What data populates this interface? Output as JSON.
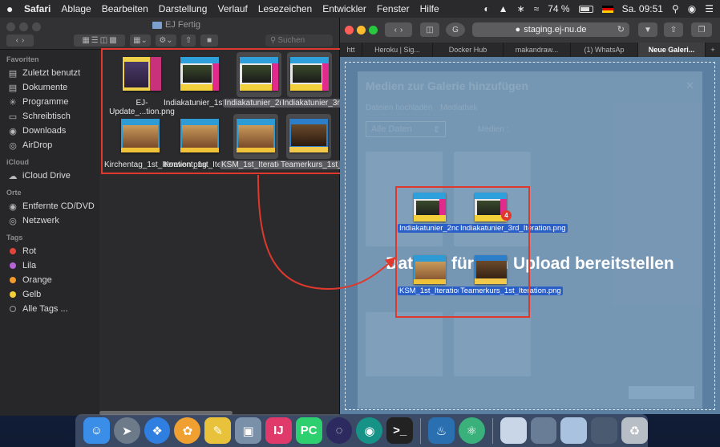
{
  "menubar": {
    "apple_icon": "apple-logo",
    "items": [
      "Safari",
      "Ablage",
      "Bearbeiten",
      "Darstellung",
      "Verlauf",
      "Lesezeichen",
      "Entwickler",
      "Fenster",
      "Hilfe"
    ],
    "battery": "74 %",
    "clock": "Sa. 09:51"
  },
  "finder": {
    "title": "EJ Fertig",
    "search_placeholder": "Suchen",
    "sidebar": {
      "favorites_heading": "Favoriten",
      "favorites": [
        {
          "label": "Zuletzt benutzt",
          "icon": "clock-icon"
        },
        {
          "label": "Dokumente",
          "icon": "document-icon"
        },
        {
          "label": "Programme",
          "icon": "apps-icon"
        },
        {
          "label": "Schreibtisch",
          "icon": "desktop-icon"
        },
        {
          "label": "Downloads",
          "icon": "download-icon"
        },
        {
          "label": "AirDrop",
          "icon": "airdrop-icon"
        }
      ],
      "icloud_heading": "iCloud",
      "icloud": [
        {
          "label": "iCloud Drive",
          "icon": "cloud-icon"
        }
      ],
      "places_heading": "Orte",
      "places": [
        {
          "label": "Entfernte CD/DVD",
          "icon": "disc-icon"
        },
        {
          "label": "Netzwerk",
          "icon": "globe-icon"
        }
      ],
      "tags_heading": "Tags",
      "tags": [
        {
          "label": "Rot",
          "color": "#e0443a"
        },
        {
          "label": "Lila",
          "color": "#b763d8"
        },
        {
          "label": "Orange",
          "color": "#f39a2c"
        },
        {
          "label": "Gelb",
          "color": "#f2cd3a"
        },
        {
          "label": "Alle Tags ...",
          "color": ""
        }
      ]
    },
    "files": [
      {
        "name": "EJ-Update_...tion.png",
        "style": "first",
        "selected": false
      },
      {
        "name": "Indiakatunier_1st_Iteration.png",
        "style": "india",
        "selected": false
      },
      {
        "name": "Indiakatunier_2nd_Iteration.png",
        "style": "india",
        "selected": true
      },
      {
        "name": "Indiakatunier_3rd_Iteration.png",
        "style": "india",
        "selected": true
      },
      {
        "name": "Kirchentag_1st_Iteration.png",
        "style": "crowd",
        "selected": false
      },
      {
        "name": "Konvent_1st_Iteration.png",
        "style": "crowd",
        "selected": false
      },
      {
        "name": "KSM_1st_Iteration.png",
        "style": "crowd",
        "selected": true
      },
      {
        "name": "Teamerkurs_1st_Iteration.png",
        "style": "team",
        "selected": true
      }
    ]
  },
  "safari": {
    "url": "staging.ej-nu.de",
    "tabs": [
      {
        "label": "htt",
        "active": false
      },
      {
        "label": "Heroku | Sig...",
        "active": false
      },
      {
        "label": "Docker Hub",
        "active": false
      },
      {
        "label": "makandraw...",
        "active": false
      },
      {
        "label": "(1) WhatsAp",
        "active": false
      },
      {
        "label": "Neue Galeri...",
        "active": true
      }
    ],
    "modal": {
      "title": "Medien zur Galerie hinzufügen",
      "tab_upload": "Dateien hochladen",
      "tab_library": "Mediathek",
      "filter": "Alle Daten",
      "media_label": "Medien :"
    },
    "drop_text": "Dateien für den Upload bereitstellen",
    "dragged_files": [
      {
        "name": "Indiakatunier_2nd_Iteration.png",
        "style": "india"
      },
      {
        "name": "Indiakatunier_3rd_Iteration.png",
        "style": "india"
      },
      {
        "name": "KSM_1st_Iteration.png",
        "style": "crowd"
      },
      {
        "name": "Teamerkurs_1st_Iteration.png",
        "style": "team"
      }
    ],
    "drag_count": "4"
  },
  "dock": {
    "apps": [
      {
        "icon": "finder-icon",
        "color": "#3b8ee8"
      },
      {
        "icon": "launchpad-icon",
        "color": "#6d7a8a"
      },
      {
        "icon": "safari-icon",
        "color": "#2f7fe0"
      },
      {
        "icon": "photos-icon",
        "color": "#f0a030"
      },
      {
        "icon": "notes-icon",
        "color": "#e8c23a"
      },
      {
        "icon": "preview-icon",
        "color": "#7a8fa8"
      },
      {
        "icon": "intellij-icon",
        "color": "#e03a6a"
      },
      {
        "icon": "pycharm-icon",
        "color": "#2ecf6e"
      },
      {
        "icon": "eclipse-icon",
        "color": "#2c2a5e"
      },
      {
        "icon": "gitkraken-icon",
        "color": "#179287"
      },
      {
        "icon": "terminal-icon",
        "color": "#222222"
      },
      {
        "icon": "mysql-icon",
        "color": "#2a6fb0"
      },
      {
        "icon": "atom-icon",
        "color": "#3ab07a"
      },
      {
        "icon": "window-1-icon",
        "color": "#c8d6e8"
      },
      {
        "icon": "window-2-icon",
        "color": "#6a7d96"
      },
      {
        "icon": "window-3-icon",
        "color": "#a8c2e0"
      },
      {
        "icon": "window-4-icon",
        "color": "#4a5a70"
      },
      {
        "icon": "trash-icon",
        "color": "#b8bec6"
      }
    ]
  }
}
